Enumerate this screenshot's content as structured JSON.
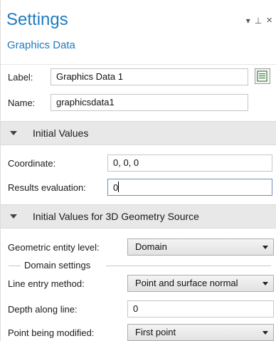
{
  "header": {
    "title": "Settings",
    "subtitle": "Graphics Data",
    "controls": {
      "dropdown": "▾",
      "pin": "⊥",
      "close": "×"
    }
  },
  "fields": {
    "label": {
      "label": "Label:",
      "value": "Graphics Data 1"
    },
    "name": {
      "label": "Name:",
      "value": "graphicsdata1"
    }
  },
  "icons": {
    "label_button": "document-list-icon"
  },
  "sections": {
    "initial_values": {
      "title": "Initial Values",
      "coordinate": {
        "label": "Coordinate:",
        "value": "0, 0, 0"
      },
      "results_evaluation": {
        "label": "Results evaluation:",
        "value": "0"
      }
    },
    "geometry_source": {
      "title": "Initial Values for 3D Geometry Source",
      "entity_level": {
        "label": "Geometric entity level:",
        "value": "Domain"
      },
      "group_label": "Domain settings",
      "line_entry": {
        "label": "Line entry method:",
        "value": "Point and surface normal"
      },
      "depth": {
        "label": "Depth along line:",
        "value": "0"
      },
      "point_modified": {
        "label": "Point being modified:",
        "value": "First point"
      }
    }
  },
  "colors": {
    "accent": "#1f7bbf",
    "section_bg": "#e8e8e8",
    "border": "#c6c6c6"
  }
}
